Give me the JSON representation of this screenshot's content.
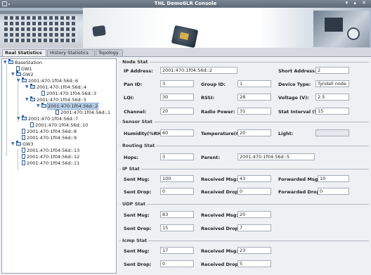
{
  "window": {
    "title": "THL Demo6LR Console",
    "controls": "▾ ▴ ✕"
  },
  "tabs": [
    "Real Statistics",
    "History Statistics",
    "Topology"
  ],
  "tree": [
    "BaseStation",
    "GW1",
    "GW2",
    "2001:470:1f04:56d::6",
    "2001:470:1f04:56d::4",
    "2001:470:1f04:56d::3",
    "2001:470:1f04:56d::5",
    "2001:470:1f04:56d::2",
    "2001:470:1f04:56d::1",
    "2001:470:1f04:56d::7",
    "2001:470:1f04:56d::10",
    "2001:470:1f04:56d::8",
    "2001:470:1f04:56d::9",
    "GW3",
    "2001:470:1f04:56d::13",
    "2001:470:1f04:56d::12",
    "2001:470:1f04:56d::11"
  ],
  "node_stat": {
    "legend": "Node Stat",
    "ip_label": "IP Address:",
    "ip": "2001:470:1f04:56d::2",
    "short_label": "Short Address:",
    "short": "2",
    "pan_label": "Pan ID:",
    "pan": "3",
    "group_label": "Group ID:",
    "group": "1",
    "devtype_label": "Device Type:",
    "devtype": "Tyndall node",
    "lqi_label": "LQI:",
    "lqi": "30",
    "rssi_label": "RSSI:",
    "rssi": "28",
    "voltage_label": "Voltage (V):",
    "voltage": "2.5",
    "channel_label": "Channel:",
    "channel": "20",
    "radio_label": "Radio Power:",
    "radio": "31",
    "interval_label": "Stat Interval (S):",
    "interval": "15"
  },
  "sensor_stat": {
    "legend": "Sensor Stat",
    "humidity_label": "Humidity(%RH):",
    "humidity": "60",
    "temp_label": "Temperature(C):",
    "temp": "20",
    "light_label": "Light:",
    "light": ""
  },
  "routing_stat": {
    "legend": "Routing Stat",
    "hops_label": "Hops:",
    "hops": "3",
    "parent_label": "Parent:",
    "parent": "2001:470:1f04:56d::5"
  },
  "ip_stat": {
    "legend": "IP Stat",
    "sent_label": "Sent Msg:",
    "sent": "100",
    "recv_label": "Received Msg:",
    "recv": "43",
    "fwd_label": "Forwarded Msg:",
    "fwd": "10",
    "sdrop_label": "Sent Drop:",
    "sdrop": "0",
    "rdrop_label": "Received Drop:",
    "rdrop": "0",
    "fdrop_label": "Forwarded Drop:",
    "fdrop": "0"
  },
  "udp_stat": {
    "legend": "UDP Stat",
    "sent_label": "Sent Msg:",
    "sent": "83",
    "recv_label": "Received Msg:",
    "recv": "20",
    "sdrop_label": "Sent Drop:",
    "sdrop": "15",
    "rdrop_label": "Received Drop:",
    "rdrop": "7"
  },
  "icmp_stat": {
    "legend": "Icmp Stat",
    "sent_label": "Sent Msg:",
    "sent": "17",
    "recv_label": "Received Msg:",
    "recv": "23",
    "sdrop_label": "Sent Drop:",
    "sdrop": "0",
    "rdrop_label": "Received Drop:",
    "rdrop": "5"
  }
}
